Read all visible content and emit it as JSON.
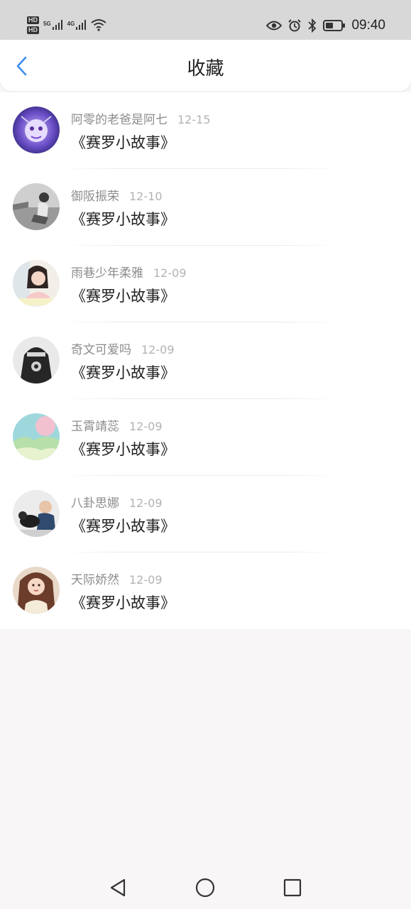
{
  "status_bar": {
    "hd_label": "HD",
    "net1": "5G",
    "net2": "4G",
    "time": "09:40"
  },
  "header": {
    "title": "收藏"
  },
  "items": [
    {
      "username": "阿零的老爸是阿七",
      "date": "12-15",
      "title": "《赛罗小故事》",
      "avatar": "anime-character-avatar"
    },
    {
      "username": "御阪振荣",
      "date": "12-10",
      "title": "《赛罗小故事》",
      "avatar": "grayscale-photo-avatar"
    },
    {
      "username": "雨巷少年柔雅",
      "date": "12-09",
      "title": "《赛罗小故事》",
      "avatar": "girl-photo-avatar"
    },
    {
      "username": "奇文可爱吗",
      "date": "12-09",
      "title": "《赛罗小故事》",
      "avatar": "dark-shirt-avatar"
    },
    {
      "username": "玉霄靖蕊",
      "date": "12-09",
      "title": "《赛罗小故事》",
      "avatar": "landscape-avatar"
    },
    {
      "username": "八卦思娜",
      "date": "12-09",
      "title": "《赛罗小故事》",
      "avatar": "child-with-dog-avatar"
    },
    {
      "username": "天际娇然",
      "date": "12-09",
      "title": "《赛罗小故事》",
      "avatar": "woman-portrait-avatar"
    }
  ],
  "colors": {
    "accent": "#3d8ef0",
    "title_text": "#1f1f1f",
    "meta_text": "#8c8c8c",
    "date_text": "#b3b3b3",
    "status_bar_bg": "#d8d8d8",
    "page_bg": "#f8f6f7"
  }
}
